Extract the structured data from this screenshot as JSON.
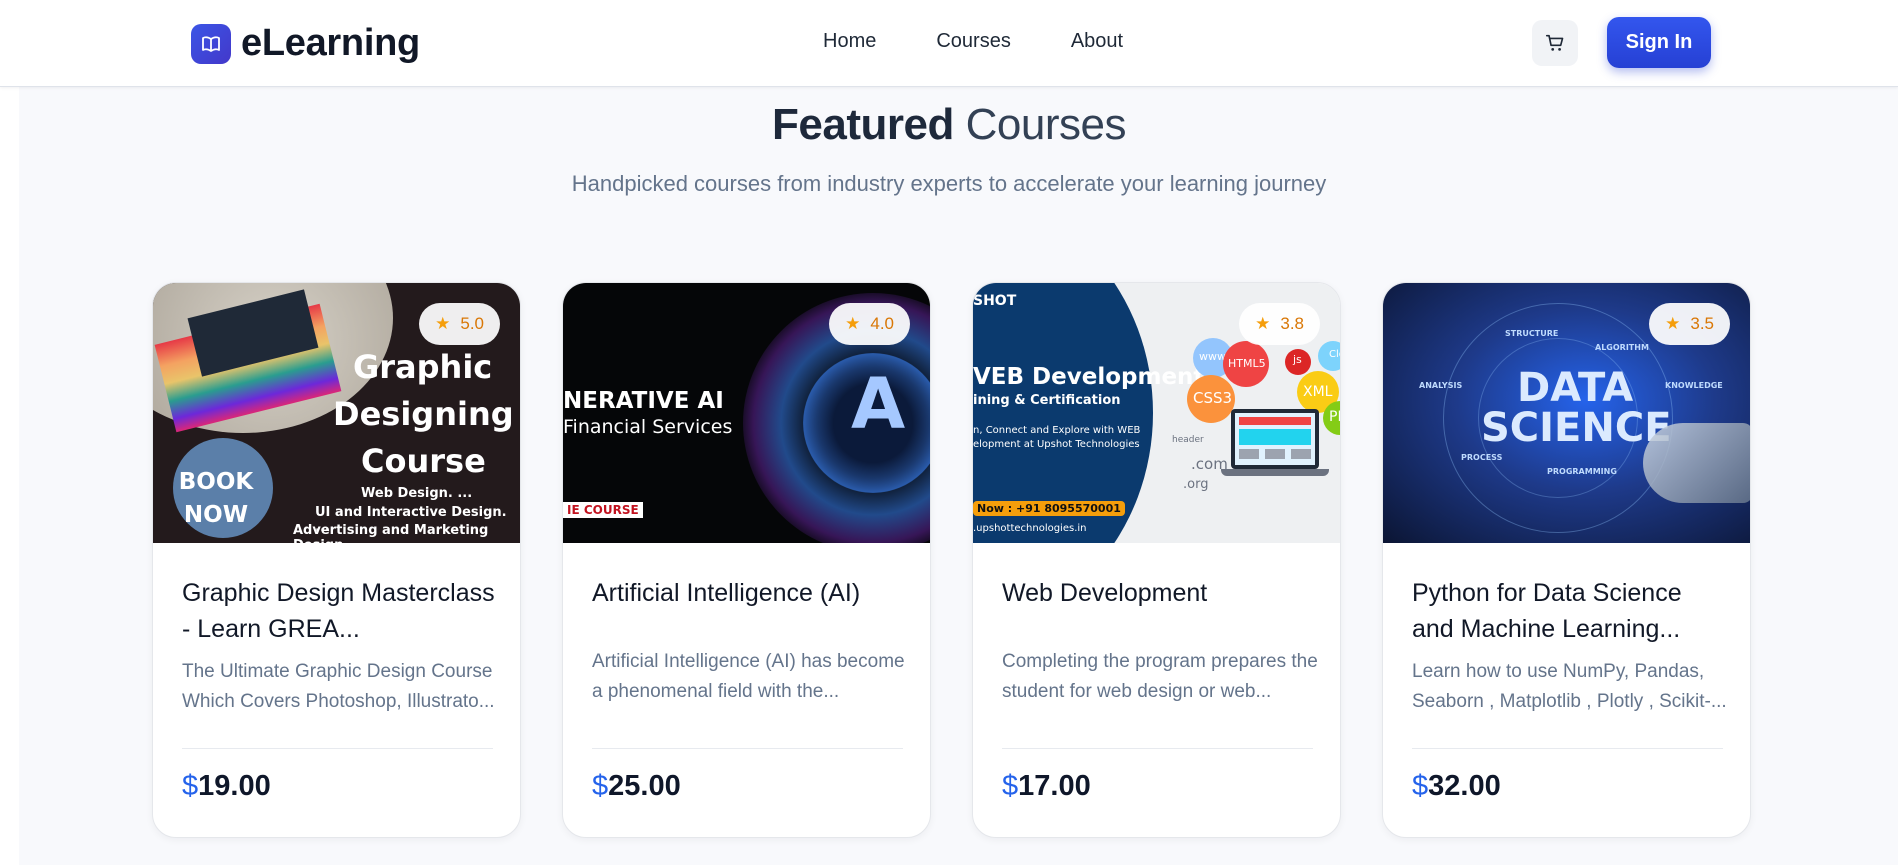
{
  "brand": {
    "name": "eLearning",
    "icon": "book-icon"
  },
  "nav": {
    "links": [
      "Home",
      "Courses",
      "About"
    ],
    "cart_icon": "cart-icon",
    "signin_label": "Sign In"
  },
  "section": {
    "title_bold": "Featured",
    "title_light": "Courses",
    "subtitle": "Handpicked courses from industry experts to accelerate your learning journey"
  },
  "colors": {
    "accent": "#2f4de0",
    "rating": "#d97706",
    "price_currency": "#2563eb"
  },
  "courses": [
    {
      "title": "Graphic Design Masterclass - Learn GREA...",
      "description": "The Ultimate Graphic Design Course Which Covers Photoshop, Illustrato...",
      "rating": "5.0",
      "currency": "$",
      "price": "19.00",
      "image": {
        "headline": [
          "Graphic",
          "Designing",
          "Course"
        ],
        "badge": [
          "BOOK",
          "NOW"
        ],
        "bullets": [
          "Web Design. ...",
          "UI and Interactive Design. ...",
          "Advertising and Marketing Design."
        ]
      }
    },
    {
      "title": "Artificial Intelligence (AI)",
      "description": "Artificial Intelligence (AI) has become a phenomenal field with the...",
      "rating": "4.0",
      "currency": "$",
      "price": "25.00",
      "image": {
        "line1": "NERATIVE AI",
        "line2": "Financial Services",
        "tag": "IE COURSE",
        "letter": "A"
      }
    },
    {
      "title": "Web Development",
      "description": "Completing the program prepares the student for web design or web...",
      "rating": "3.8",
      "currency": "$",
      "price": "17.00",
      "image": {
        "logo": "SHOT",
        "line1": "VEB Development",
        "line2": "ining & Certification",
        "line3": "n, Connect and Explore with WEB",
        "line4": "elopment at Upshot Technologies",
        "phone": "Now : +91 8095570001",
        "url": ".upshottechnologies.in",
        "bubbles": [
          "www",
          "HTML5",
          "js",
          "CSS3",
          "XML",
          "PH",
          "Clo"
        ],
        "tlds": [
          ".com",
          ".org",
          "header"
        ]
      }
    },
    {
      "title": "Python for Data Science and Machine Learning...",
      "description": "Learn how to use NumPy, Pandas, Seaborn , Matplotlib , Plotly , Scikit-...",
      "rating": "3.5",
      "currency": "$",
      "price": "32.00",
      "image": {
        "line1": "DATA",
        "line2": "SCIENCE",
        "labels": [
          "STRUCTURE",
          "ALGORITHM",
          "ANALYSIS",
          "KNOWLEDGE",
          "PROCESS",
          "PROGRAMMING"
        ]
      }
    }
  ]
}
